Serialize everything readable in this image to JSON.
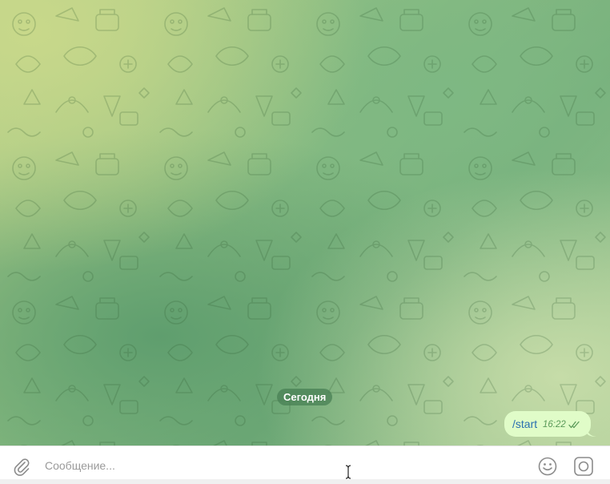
{
  "chat": {
    "date_separator": "Сегодня",
    "messages": [
      {
        "text": "/start",
        "time": "16:22",
        "status_icon": "double-check-icon"
      }
    ]
  },
  "composer": {
    "placeholder": "Сообщение...",
    "value": "",
    "icons": {
      "attach": "paperclip-icon",
      "emoji": "emoji-icon",
      "camera": "camera-icon"
    }
  },
  "colors": {
    "bubble": "#e0fcc8",
    "command_link": "#2a6fb0",
    "time": "#5b9a5a",
    "date_pill": "#488054"
  }
}
